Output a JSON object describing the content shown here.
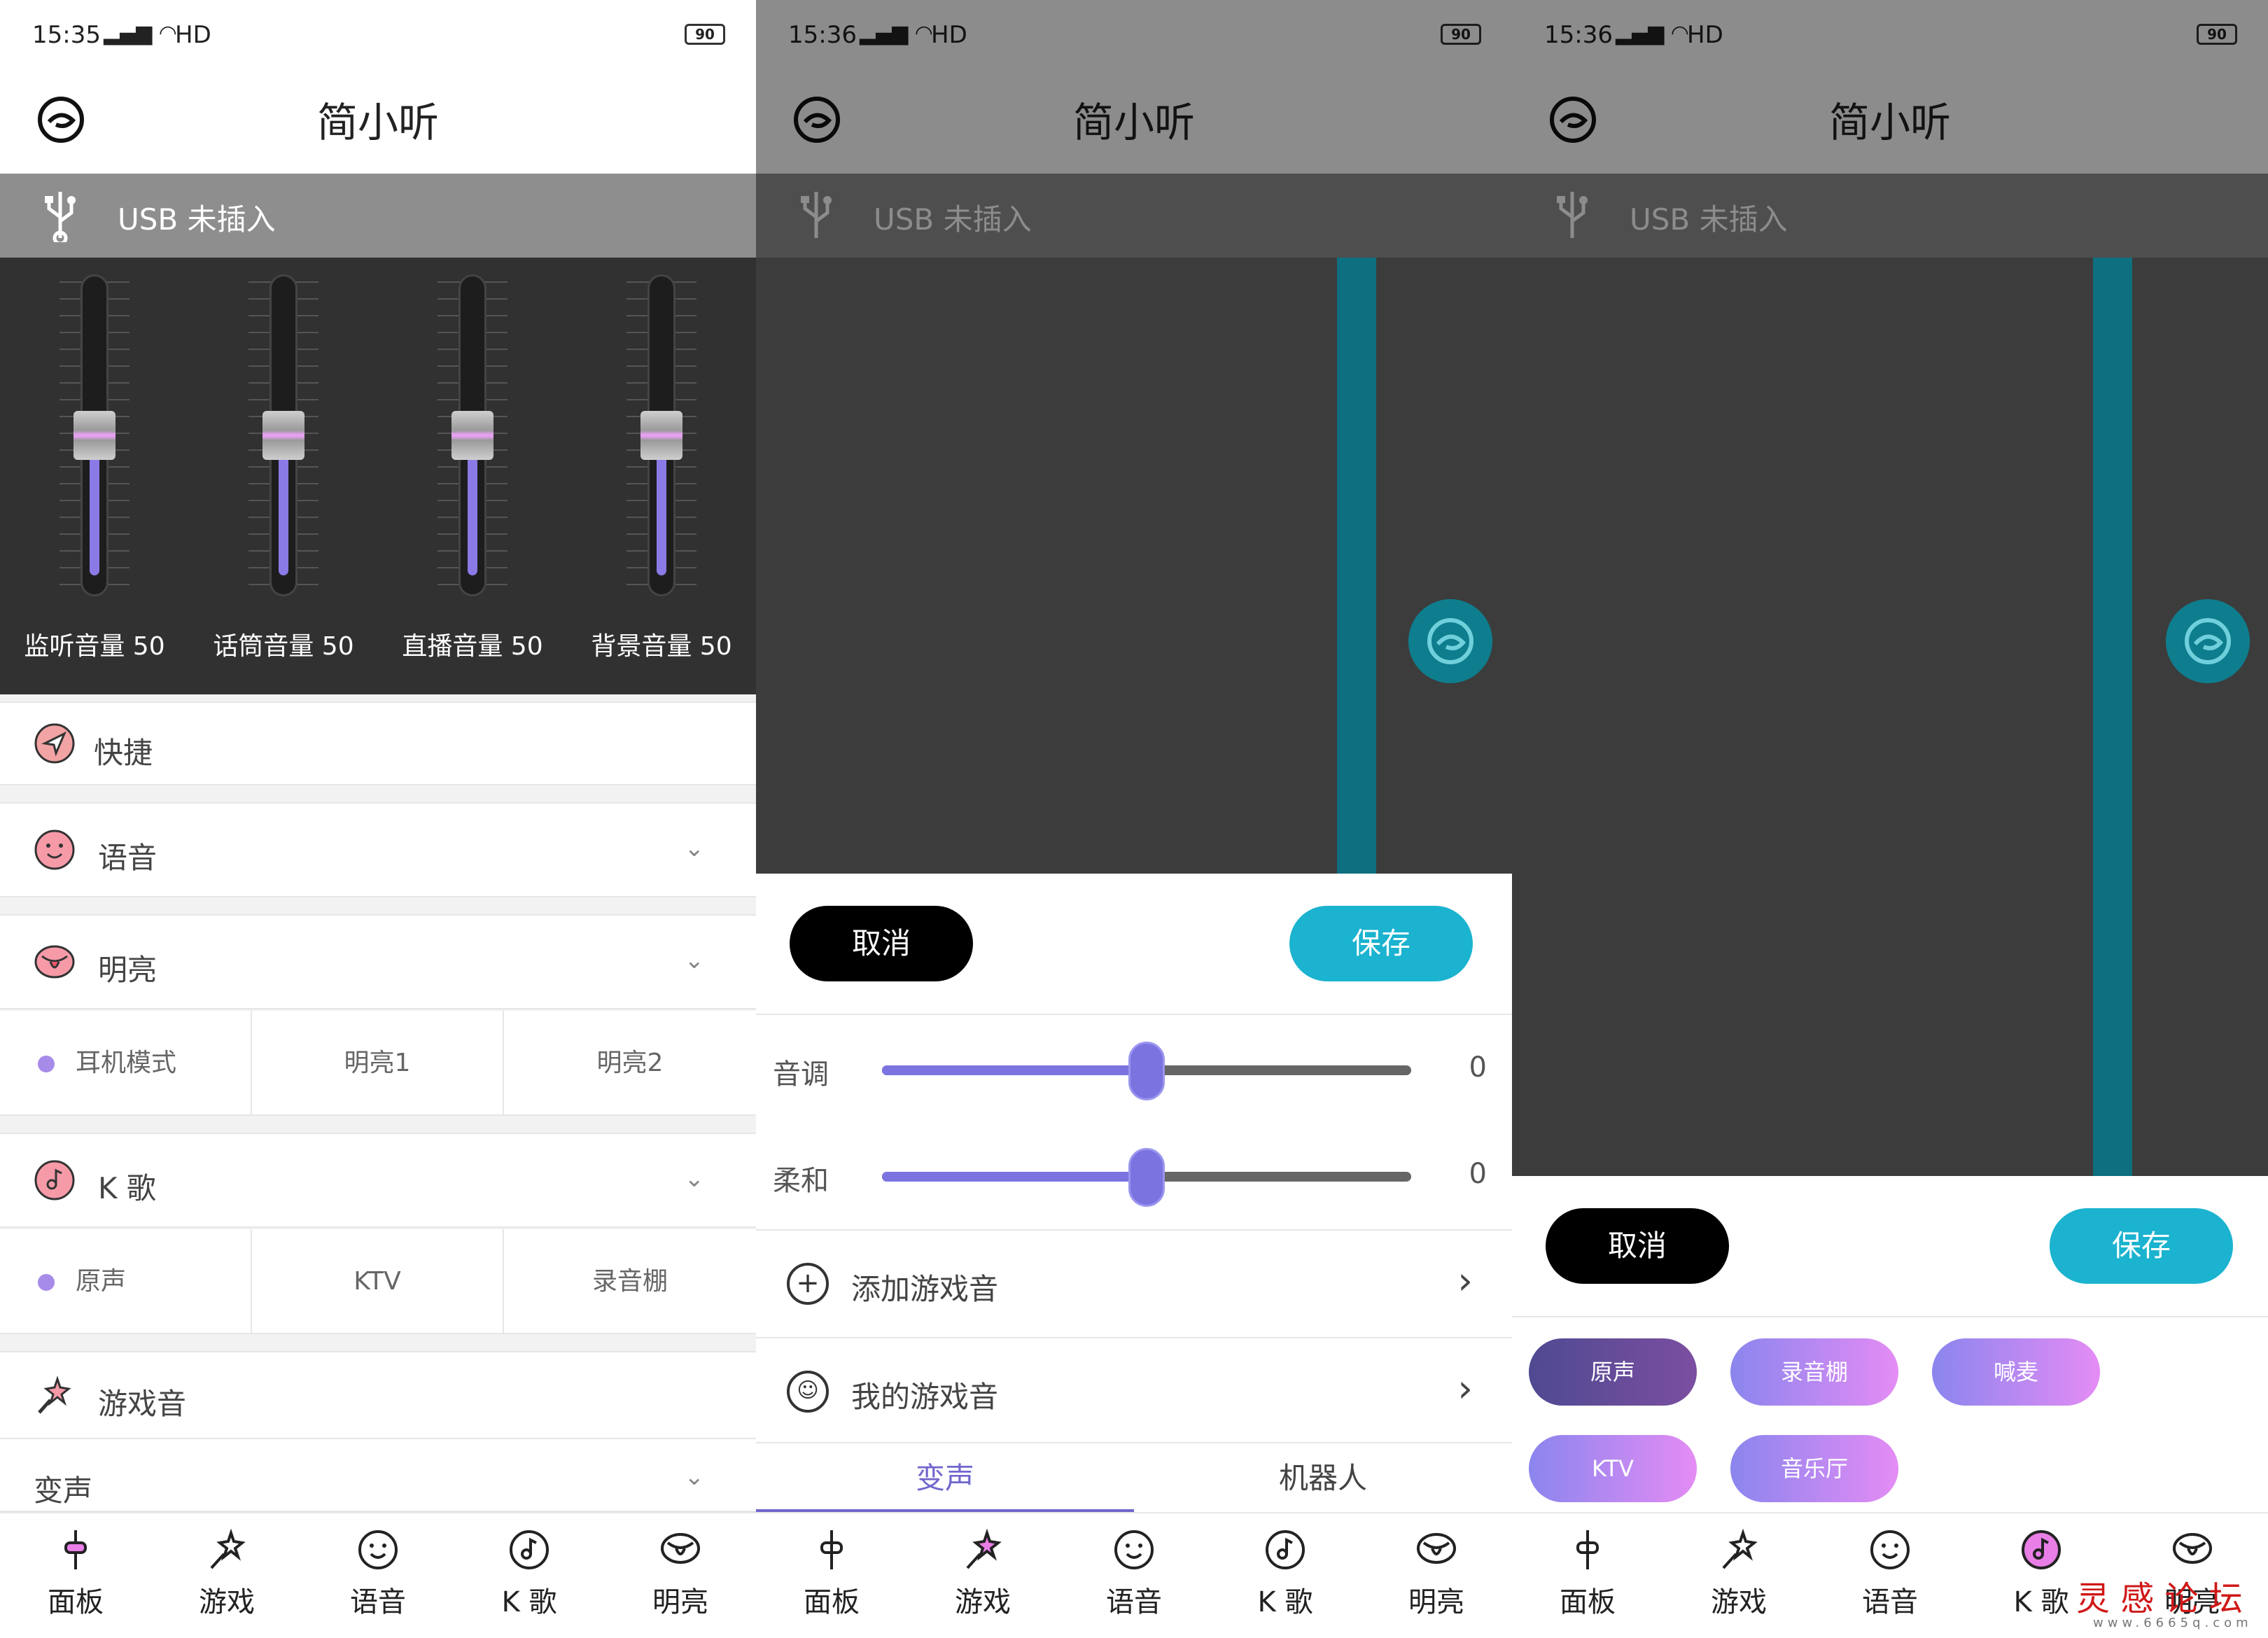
{
  "app_title": "简小听",
  "usb_text": "USB 未插入",
  "status": {
    "p1": {
      "time": "15:35",
      "signal": "4G",
      "hd": "HD",
      "battery": "90"
    },
    "p2": {
      "time": "15:36",
      "signal": "4G",
      "hd": "HD",
      "battery": "90"
    },
    "p3": {
      "time": "15:36",
      "signal": "4G",
      "hd": "HD",
      "battery": "90"
    }
  },
  "faders": [
    {
      "label": "监听音量 50",
      "level": 0.5
    },
    {
      "label": "话筒音量 50",
      "level": 0.5
    },
    {
      "label": "直播音量 50",
      "level": 0.5
    },
    {
      "label": "背景音量 50",
      "level": 0.5
    }
  ],
  "sections": {
    "quick": "快捷",
    "voice": "语音",
    "bright": "明亮",
    "bright_options": [
      "耳机模式",
      "明亮1",
      "明亮2"
    ],
    "karaoke": "K 歌",
    "karaoke_options": [
      "原声",
      "KTV",
      "录音棚"
    ],
    "game_sound": "游戏音",
    "voice_change": "变声"
  },
  "nav": [
    "面板",
    "游戏",
    "语音",
    "K 歌",
    "明亮"
  ],
  "sheet_game": {
    "cancel": "取消",
    "save": "保存",
    "sliders": [
      {
        "label": "音调",
        "value": "0",
        "position": 0.5
      },
      {
        "label": "柔和",
        "value": "0",
        "position": 0.5
      }
    ],
    "links": [
      "添加游戏音",
      "我的游戏音"
    ],
    "tabs": [
      "变声",
      "机器人"
    ]
  },
  "sheet_karaoke": {
    "cancel": "取消",
    "save": "保存",
    "pills": [
      "原声",
      "录音棚",
      "喊麦",
      "KTV",
      "音乐厅"
    ]
  },
  "watermark": {
    "text": "灵 感 论 坛",
    "sub": "www.6665q.com"
  },
  "colors": {
    "accent_purple": "#7066cc",
    "teal": "#1bb3cf",
    "dark_teal": "#0e6f80"
  }
}
